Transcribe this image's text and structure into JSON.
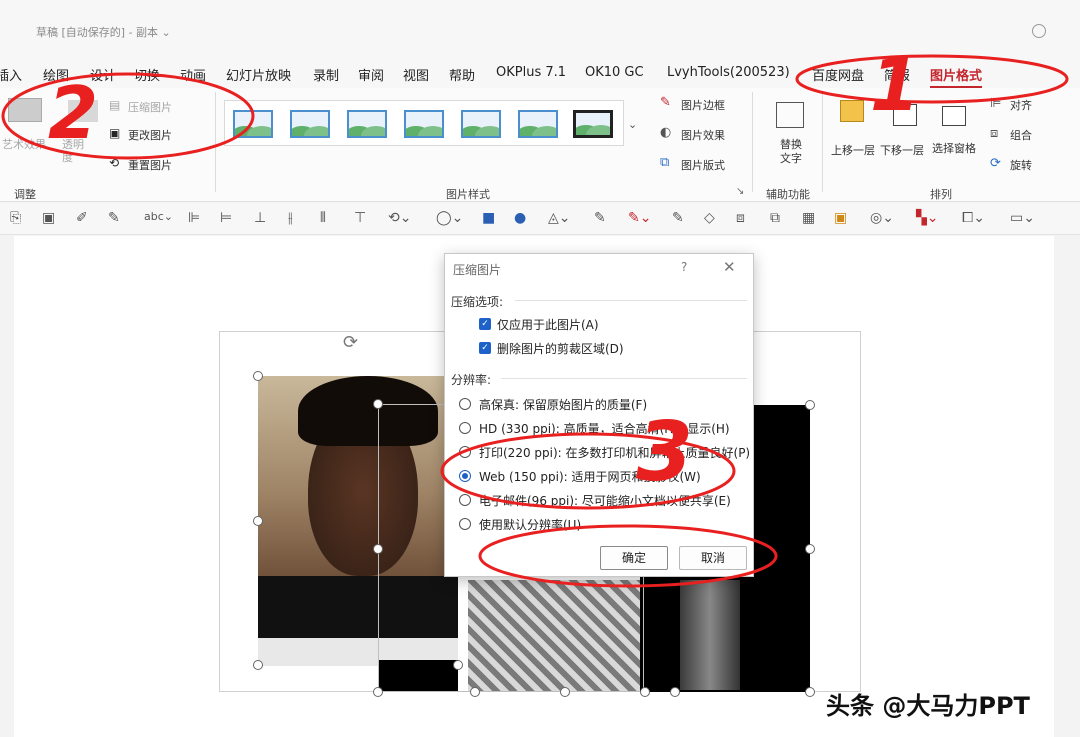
{
  "window": {
    "title": "草稿 [自动保存的] - 副本 ⌄"
  },
  "tabs": [
    "插入",
    "绘图",
    "设计",
    "切换",
    "动画",
    "幻灯片放映",
    "录制",
    "审阅",
    "视图",
    "帮助",
    "OKPlus 7.1",
    "OK10 GC",
    "LvyhTools(200523)",
    "百度网盘",
    "简报",
    "图片格式"
  ],
  "ribbon": {
    "adjust": {
      "items": [
        "艺术效果",
        "透明度",
        "压缩图片",
        "更改图片",
        "重置图片"
      ],
      "group_label": "调整"
    },
    "picture_styles": {
      "border": "图片边框",
      "effects": "图片效果",
      "layout": "图片版式",
      "group_label": "图片样式"
    },
    "accessibility": {
      "alt_text": "替换文字",
      "group_label": "辅助功能"
    },
    "arrange": {
      "bring_forward": "上移一层",
      "send_backward": "下移一层",
      "selection_pane": "选择窗格",
      "align": "对齐",
      "group": "组合",
      "rotate": "旋转",
      "group_label": "排列"
    }
  },
  "dialog": {
    "title": "压缩图片",
    "help": "?",
    "close": "✕",
    "compress_section": "压缩选项:",
    "options": [
      {
        "label": "仅应用于此图片(A)",
        "checked": true
      },
      {
        "label": "删除图片的剪裁区域(D)",
        "checked": true
      }
    ],
    "resolution_section": "分辨率:",
    "resolutions": [
      {
        "label": "高保真: 保留原始图片的质量(F)",
        "selected": false
      },
      {
        "label": "HD (330 ppi): 高质量，适合高清(HD)显示(H)",
        "selected": false
      },
      {
        "label": "打印(220 ppi): 在多数打印机和屏幕上质量良好(P)",
        "selected": false
      },
      {
        "label": "Web (150 ppi): 适用于网页和投影仪(W)",
        "selected": true
      },
      {
        "label": "电子邮件(96 ppi): 尽可能缩小文档以便共享(E)",
        "selected": false
      },
      {
        "label": "使用默认分辨率(U)",
        "selected": false
      }
    ],
    "ok": "确定",
    "cancel": "取消"
  },
  "annotations": {
    "num1": "1",
    "num2": "2",
    "num3": "3",
    "color": "#e8201f"
  },
  "watermark": "头条 @大马力PPT"
}
